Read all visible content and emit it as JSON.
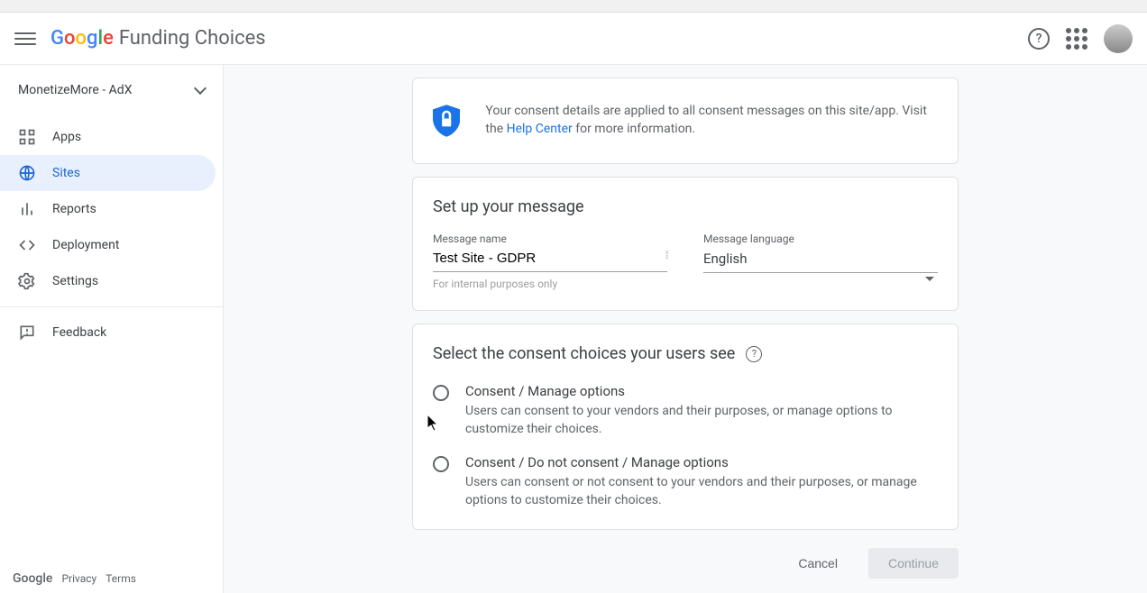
{
  "header": {
    "product_name": "Funding Choices"
  },
  "account": {
    "name": "MonetizeMore - AdX"
  },
  "nav": {
    "apps": "Apps",
    "sites": "Sites",
    "reports": "Reports",
    "deployment": "Deployment",
    "settings": "Settings",
    "feedback": "Feedback"
  },
  "footer": {
    "google": "Google",
    "privacy": "Privacy",
    "terms": "Terms"
  },
  "info": {
    "text_before": "Your consent details are applied to all consent messages on this site/app. Visit the ",
    "link": "Help Center",
    "text_after": " for more information."
  },
  "setup": {
    "title": "Set up your message",
    "name_label": "Message name",
    "name_value": "Test Site - GDPR",
    "name_hint": "For internal purposes only",
    "lang_label": "Message language",
    "lang_value": "English"
  },
  "choices": {
    "title": "Select the consent choices your users see",
    "opt1_title": "Consent / Manage options",
    "opt1_desc": "Users can consent to your vendors and their purposes, or manage options to customize their choices.",
    "opt2_title": "Consent / Do not consent / Manage options",
    "opt2_desc": "Users can consent or not consent to your vendors and their purposes, or manage options to customize their choices."
  },
  "actions": {
    "cancel": "Cancel",
    "continue": "Continue"
  }
}
